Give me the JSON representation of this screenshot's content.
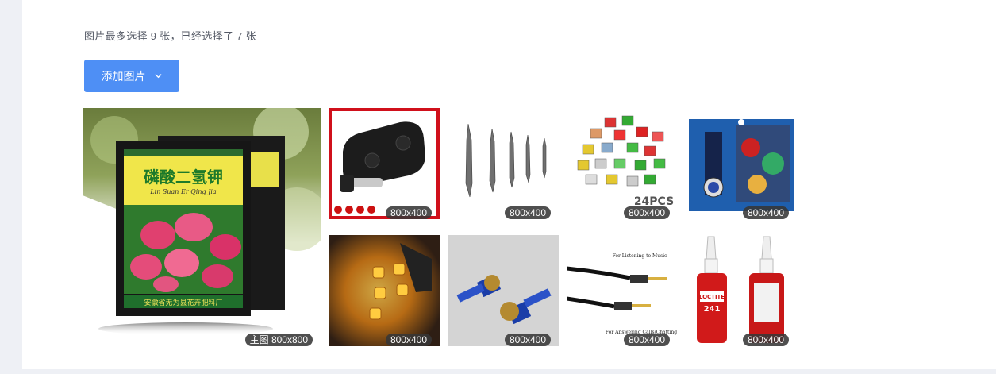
{
  "hint_text": "图片最多选择 9 张，已经选择了 7 张",
  "add_button": {
    "label": "添加图片"
  },
  "main_image": {
    "badge": "主图 800x800",
    "product_title": "磷酸二氢钾",
    "product_pinyin": "Lin Suan Er Qing Jia",
    "product_maker": "安徽省无为县花卉肥料厂"
  },
  "thumbnails": [
    {
      "name": "car-key-image",
      "badge": "800x400",
      "selected": true
    },
    {
      "name": "center-drill-bits-image",
      "badge": "800x400",
      "selected": false
    },
    {
      "name": "blade-fuses-image",
      "badge": "800x400",
      "selected": false,
      "caption": "24PCS"
    },
    {
      "name": "watch-wallet-set-image",
      "badge": "800x400",
      "selected": false
    },
    {
      "name": "amber-led-bulb-image",
      "badge": "800x400",
      "selected": false
    },
    {
      "name": "blue-bolts-image",
      "badge": "800x400",
      "selected": false
    },
    {
      "name": "audio-cable-image",
      "badge": "800x400",
      "selected": false,
      "caption_top": "For Listening to Music",
      "caption_bottom": "For Answering Calls/Chatting"
    },
    {
      "name": "threadlocker-image",
      "badge": "800x400",
      "selected": false,
      "label": "LOCTITE",
      "number": "241"
    }
  ]
}
